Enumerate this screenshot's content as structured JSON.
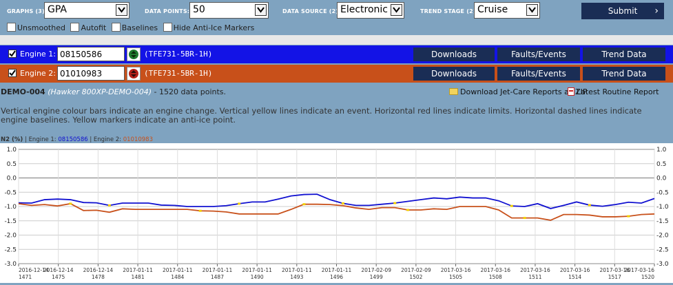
{
  "controls": {
    "graphs_label": "GRAPHS (3):",
    "graphs_value": "GPA",
    "datapoints_label": "DATA POINTS:",
    "datapoints_value": "50",
    "datasource_label": "DATA SOURCE (2):",
    "datasource_value": "Electronic",
    "trendstage_label": "TREND STAGE (2):",
    "trendstage_value": "Cruise",
    "submit_label": "Submit",
    "options": [
      "Unsmoothed",
      "Autofit",
      "Baselines",
      "Hide Anti-Ice Markers"
    ]
  },
  "engines": [
    {
      "label": "Engine 1:",
      "serial": "08150586",
      "model": "(TFE731-5BR-1H)",
      "color": "#1313e6"
    },
    {
      "label": "Engine 2:",
      "serial": "01010983",
      "model": "(TFE731-5BR-1H)",
      "color": "#c8501a"
    }
  ],
  "engine_buttons": [
    "Downloads",
    "Faults/Events",
    "Trend Data"
  ],
  "aircraft": {
    "id": "DEMO-004",
    "type": "(Hawker 800XP-DEMO-004)",
    "points": "- 1520 data points."
  },
  "links": {
    "zip": "Download Jet-Care Reports as ZIP",
    "routine": "Latest Routine Report"
  },
  "description": "Vertical engine colour bars indicate an engine change. Vertical yellow lines indicate an event. Horizontal red lines indicate limits. Horizontal dashed lines indicate engine baselines. Yellow markers indicate an anti-ice point.",
  "legend": {
    "param": "N2 (%)",
    "sep": " | ",
    "e1_label": "Engine 1: ",
    "e1_serial": "08150586",
    "e2_label": "Engine 2: ",
    "e2_serial": "01010983"
  },
  "chart_data": {
    "type": "line",
    "ylim": [
      -3.0,
      1.0
    ],
    "yticks": [
      "1.0",
      "0.5",
      "0.0",
      "-0.5",
      "-1.0",
      "-1.5",
      "-2.0",
      "-2.5",
      "-3.0"
    ],
    "x_dates": [
      "2016-12-14",
      "2016-12-14",
      "2016-12-14",
      "2017-01-11",
      "2017-01-11",
      "2017-01-11",
      "2017-01-11",
      "2017-01-11",
      "2017-01-11",
      "2017-02-09",
      "2017-02-09",
      "2017-03-16",
      "2017-03-16",
      "2017-03-16",
      "2017-03-16",
      "2017-03-16",
      "2017-03-16"
    ],
    "x_ids": [
      "1471",
      "1475",
      "1478",
      "1481",
      "1484",
      "1487",
      "1490",
      "1493",
      "1496",
      "1499",
      "1502",
      "1505",
      "1508",
      "1511",
      "1514",
      "1517",
      "1520"
    ],
    "series": [
      {
        "name": "Engine 1: 08150586",
        "color": "#1010d0",
        "values": [
          -0.87,
          -0.88,
          -0.76,
          -0.74,
          -0.76,
          -0.86,
          -0.87,
          -0.96,
          -0.88,
          -0.88,
          -0.88,
          -0.95,
          -0.96,
          -1.0,
          -1.0,
          -1.0,
          -0.97,
          -0.9,
          -0.84,
          -0.84,
          -0.74,
          -0.63,
          -0.58,
          -0.57,
          -0.76,
          -0.89,
          -0.96,
          -0.96,
          -0.92,
          -0.88,
          -0.82,
          -0.76,
          -0.7,
          -0.73,
          -0.67,
          -0.7,
          -0.7,
          -0.8,
          -0.98,
          -1.0,
          -0.9,
          -1.07,
          -0.96,
          -0.84,
          -0.95,
          -0.99,
          -0.93,
          -0.85,
          -0.88,
          -0.72
        ]
      },
      {
        "name": "Engine 2: 01010983",
        "color": "#c8501a",
        "values": [
          -0.9,
          -0.96,
          -0.93,
          -0.98,
          -0.9,
          -1.14,
          -1.13,
          -1.2,
          -1.08,
          -1.1,
          -1.1,
          -1.1,
          -1.1,
          -1.1,
          -1.15,
          -1.16,
          -1.19,
          -1.26,
          -1.26,
          -1.26,
          -1.26,
          -1.1,
          -0.92,
          -0.92,
          -0.93,
          -0.97,
          -1.05,
          -1.1,
          -1.04,
          -1.04,
          -1.12,
          -1.12,
          -1.08,
          -1.1,
          -1.0,
          -1.0,
          -1.0,
          -1.12,
          -1.4,
          -1.4,
          -1.4,
          -1.48,
          -1.28,
          -1.28,
          -1.3,
          -1.36,
          -1.36,
          -1.34,
          -1.28,
          -1.26
        ]
      }
    ],
    "anti_ice_markers": {
      "series0": [
        7,
        17,
        25,
        29,
        38,
        44
      ],
      "series1": [
        4,
        14,
        22,
        30,
        39,
        47
      ]
    }
  }
}
